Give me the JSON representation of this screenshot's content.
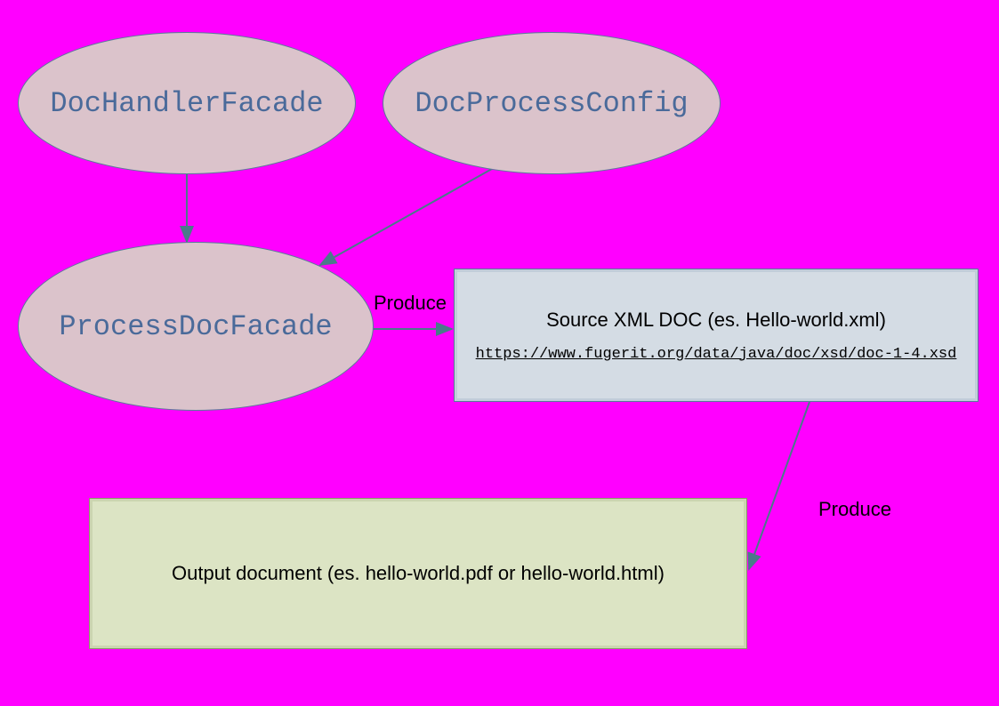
{
  "nodes": {
    "docHandlerFacade": {
      "label": "DocHandlerFacade"
    },
    "docProcessConfig": {
      "label": "DocProcessConfig"
    },
    "processDocFacade": {
      "label": "ProcessDocFacade"
    },
    "sourceBox": {
      "title": "Source XML DOC (es. Hello-world.xml)",
      "link": "https://www.fugerit.org/data/java/doc/xsd/doc-1-4.xsd"
    },
    "outputBox": {
      "text": "Output document (es. hello-world.pdf or hello-world.html)"
    }
  },
  "edges": {
    "produce1": {
      "label": "Produce"
    },
    "produce2": {
      "label": "Produce"
    }
  },
  "colors": {
    "background": "#ff00ff",
    "ellipseFill": "#dbc3cb",
    "ellipseStroke": "#5a7a9a",
    "ellipseText": "#4a6a9a",
    "blueBoxFill": "#d4dce4",
    "greenBoxFill": "#dce4c4",
    "arrowStroke": "#4a7a8a"
  }
}
